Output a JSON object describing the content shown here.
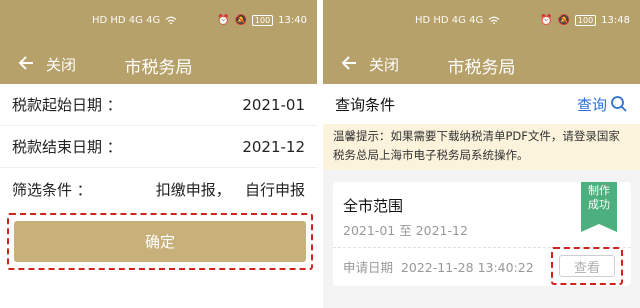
{
  "status": {
    "left_icons": "HD HD 4G 4G",
    "left_time": "13:40",
    "right_time": "13:48",
    "battery": "100",
    "icons": [
      "signal-icon",
      "wifi-icon",
      "alarm-icon",
      "mute-icon",
      "battery-icon"
    ]
  },
  "left": {
    "nav": {
      "close": "关闭",
      "title": "市税务局"
    },
    "form": [
      {
        "label": "税款起始日期 ：",
        "value": "2021-01"
      },
      {
        "label": "税款结束日期 ：",
        "value": "2021-12"
      },
      {
        "label": "筛选条件 ：",
        "value": "扣缴申报，   自行申报"
      }
    ],
    "confirm": "确定"
  },
  "right": {
    "nav": {
      "close": "关闭",
      "title": "市税务局"
    },
    "query_title": "查询条件",
    "query_action": "查询",
    "tip": "温馨提示：如果需要下载纳税清单PDF文件，请登录国家税务总局上海市电子税务局系统操作。",
    "card": {
      "title": "全市范围",
      "range": "2021-01 至 2021-12",
      "apply_date": "申请日期  2022-11-28 13:40:22",
      "ribbon": "制作\n成功",
      "view": "查看"
    }
  },
  "colors": {
    "header": "#b7a16a",
    "confirm": "#c8b07a",
    "link": "#2e6fd6",
    "success": "#4caf7d",
    "annotation": "#d0231c"
  }
}
